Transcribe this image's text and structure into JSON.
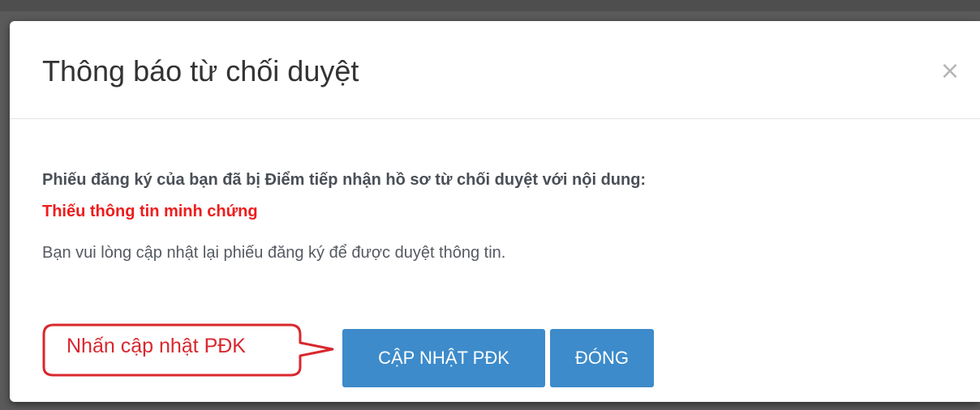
{
  "dialog": {
    "title": "Thông báo từ chối duyệt",
    "close_symbol": "×"
  },
  "body": {
    "main_text": "Phiếu đăng ký của bạn đã bị Điểm tiếp nhận hồ sơ từ chối duyệt với nội dung:",
    "reason_text": "Thiếu thông tin minh chứng",
    "hint_text": "Bạn vui lòng cập nhật lại phiếu đăng ký để được duyệt thông tin."
  },
  "annotation": {
    "callout_text": "Nhấn cập nhật PĐK"
  },
  "footer": {
    "update_button": "CẬP NHẬT PĐK",
    "close_button": "ĐÓNG"
  },
  "colors": {
    "primary_button": "#3d8bca",
    "reason_red": "#ee1c1c",
    "callout_border": "#d9272e"
  }
}
